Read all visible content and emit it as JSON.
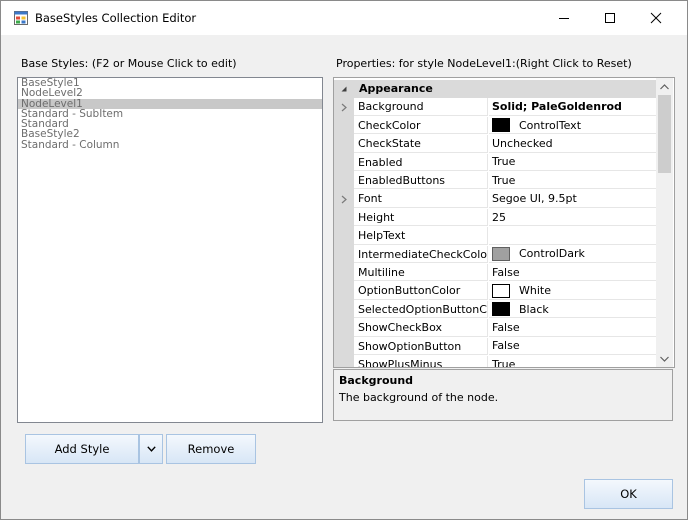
{
  "window": {
    "title": "BaseStyles Collection Editor",
    "app_icon": "form-designer-icon",
    "controls": {
      "minimize_icon": "minimize-icon",
      "maximize_icon": "maximize-icon",
      "close_icon": "close-icon"
    }
  },
  "left_panel": {
    "label": "Base Styles: (F2 or Mouse Click to edit)",
    "items": [
      {
        "label": "BaseStyle1",
        "selected": false
      },
      {
        "label": "NodeLevel2",
        "selected": false
      },
      {
        "label": "NodeLevel1",
        "selected": true
      },
      {
        "label": "Standard - SubItem",
        "selected": false
      },
      {
        "label": "Standard",
        "selected": false
      },
      {
        "label": "BaseStyle2",
        "selected": false
      },
      {
        "label": "Standard - Column",
        "selected": false
      }
    ],
    "add_button": "Add Style",
    "remove_button": "Remove"
  },
  "properties": {
    "label": "Properties: for style NodeLevel1:(Right Click to Reset)",
    "category": "Appearance",
    "rows": [
      {
        "name": "Background",
        "value": "Solid; PaleGoldenrod",
        "bold": true,
        "expandable": true
      },
      {
        "name": "CheckColor",
        "value": "ControlText",
        "swatch": "#000000"
      },
      {
        "name": "CheckState",
        "value": "Unchecked"
      },
      {
        "name": "Enabled",
        "value": "True"
      },
      {
        "name": "EnabledButtons",
        "value": "True"
      },
      {
        "name": "Font",
        "value": "Segoe UI, 9.5pt",
        "expandable": true
      },
      {
        "name": "Height",
        "value": "25"
      },
      {
        "name": "HelpText",
        "value": ""
      },
      {
        "name": "IntermediateCheckColor",
        "value": "ControlDark",
        "swatch": "#a0a0a0"
      },
      {
        "name": "Multiline",
        "value": "False"
      },
      {
        "name": "OptionButtonColor",
        "value": "White",
        "swatch": "#ffffff"
      },
      {
        "name": "SelectedOptionButtonCc",
        "value": "Black",
        "swatch": "#000000"
      },
      {
        "name": "ShowCheckBox",
        "value": "False"
      },
      {
        "name": "ShowOptionButton",
        "value": "False"
      },
      {
        "name": "ShowPlusMinus",
        "value": "True"
      }
    ],
    "help_title": "Background",
    "help_desc": "The background of the node."
  },
  "footer": {
    "ok_button": "OK"
  }
}
